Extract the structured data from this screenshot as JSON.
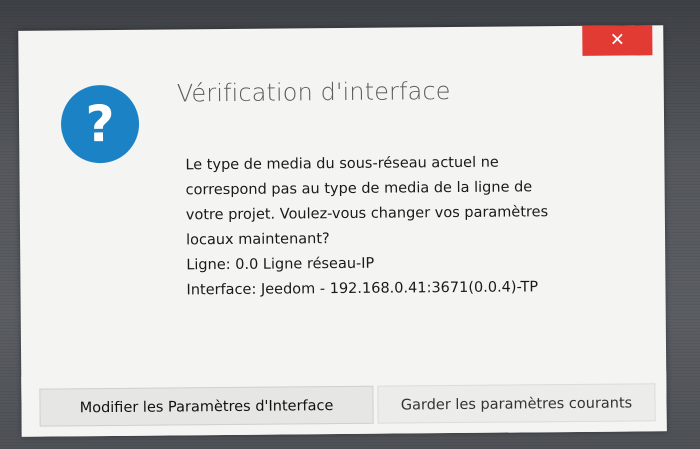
{
  "dialog": {
    "title": "Vérification d'interface",
    "close_glyph": "✕",
    "icon": "question-icon",
    "icon_glyph": "?",
    "message_lines": [
      "Le type de media du sous-réseau actuel ne",
      "correspond pas au type de media de la ligne de",
      "votre projet. Voulez-vous changer vos paramètres",
      "locaux maintenant?",
      "Ligne: 0.0 Ligne réseau-IP",
      "Interface: Jeedom - 192.168.0.41:3671(0.0.4)-TP"
    ],
    "buttons": {
      "modify_label": "Modifier les Paramètres d'Interface",
      "keep_label": "Garder les paramètres courants"
    }
  },
  "colors": {
    "close_button": "#e23b34",
    "icon_background": "#1b82c5",
    "dialog_background": "#f4f4f2",
    "title_text": "#5a5a5a"
  }
}
